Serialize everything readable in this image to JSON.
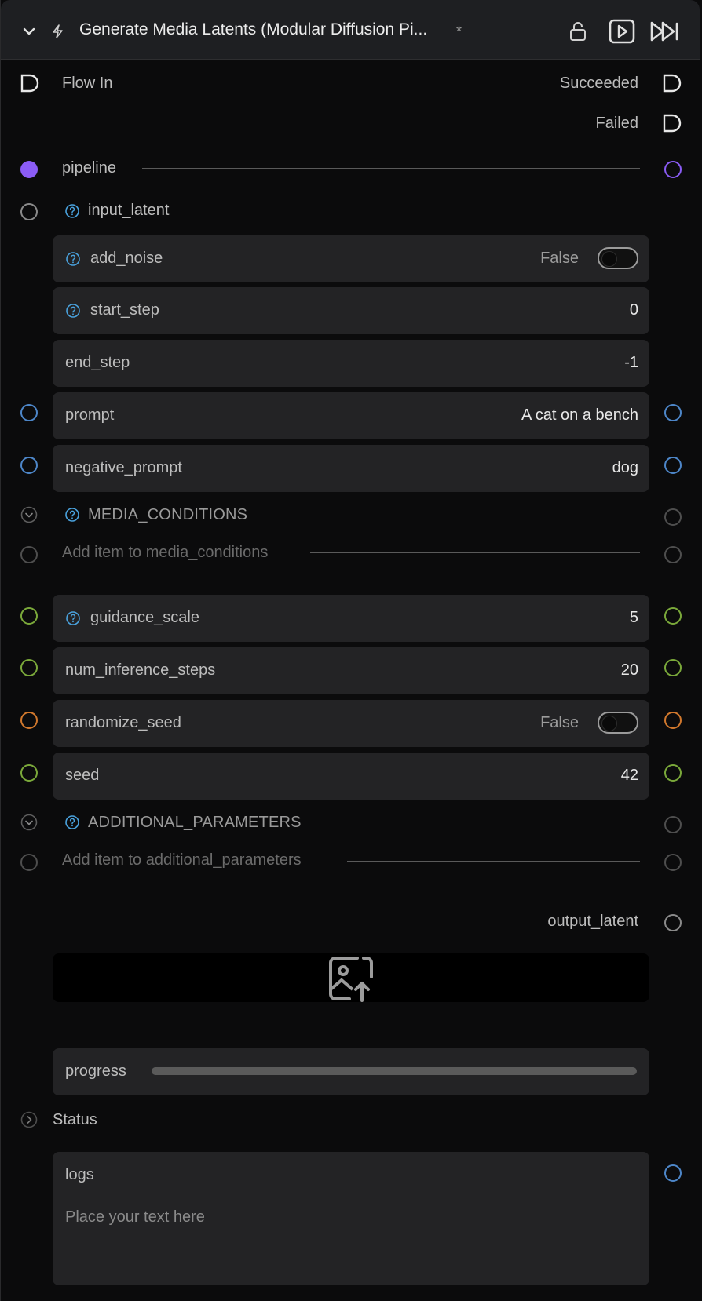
{
  "header": {
    "title": "Generate Media Latents (Modular Diffusion Pi...",
    "modified_marker": "*"
  },
  "flow": {
    "in_label": "Flow In",
    "succeeded": "Succeeded",
    "failed": "Failed"
  },
  "pipeline": {
    "label": "pipeline"
  },
  "input_latent": {
    "label": "input_latent"
  },
  "params": {
    "add_noise": {
      "label": "add_noise",
      "value": "False"
    },
    "start_step": {
      "label": "start_step",
      "value": "0"
    },
    "end_step": {
      "label": "end_step",
      "value": "-1"
    },
    "prompt": {
      "label": "prompt",
      "value": "A cat on a bench"
    },
    "negative_prompt": {
      "label": "negative_prompt",
      "value": "dog"
    },
    "guidance_scale": {
      "label": "guidance_scale",
      "value": "5"
    },
    "num_inference_steps": {
      "label": "num_inference_steps",
      "value": "20"
    },
    "randomize_seed": {
      "label": "randomize_seed",
      "value": "False"
    },
    "seed": {
      "label": "seed",
      "value": "42"
    }
  },
  "media_conditions": {
    "title": "MEDIA_CONDITIONS",
    "add_item": "Add item to media_conditions"
  },
  "additional_parameters": {
    "title": "ADDITIONAL_PARAMETERS",
    "add_item": "Add item to additional_parameters"
  },
  "output": {
    "label": "output_latent"
  },
  "progress": {
    "label": "progress",
    "value": 0
  },
  "status": {
    "label": "Status"
  },
  "logs": {
    "label": "logs",
    "placeholder": "Place your text here"
  },
  "colors": {
    "purple": "#8b5cf6",
    "blue": "#4d86c8",
    "green": "#7aa83a",
    "orange": "#d1782d",
    "help": "#4aa3df"
  },
  "icons": [
    "chevron-down-icon",
    "lightning-icon",
    "unlock-icon",
    "play-icon",
    "fast-forward-icon",
    "help-circle-icon",
    "image-upload-icon",
    "chevron-right-circle-icon"
  ]
}
